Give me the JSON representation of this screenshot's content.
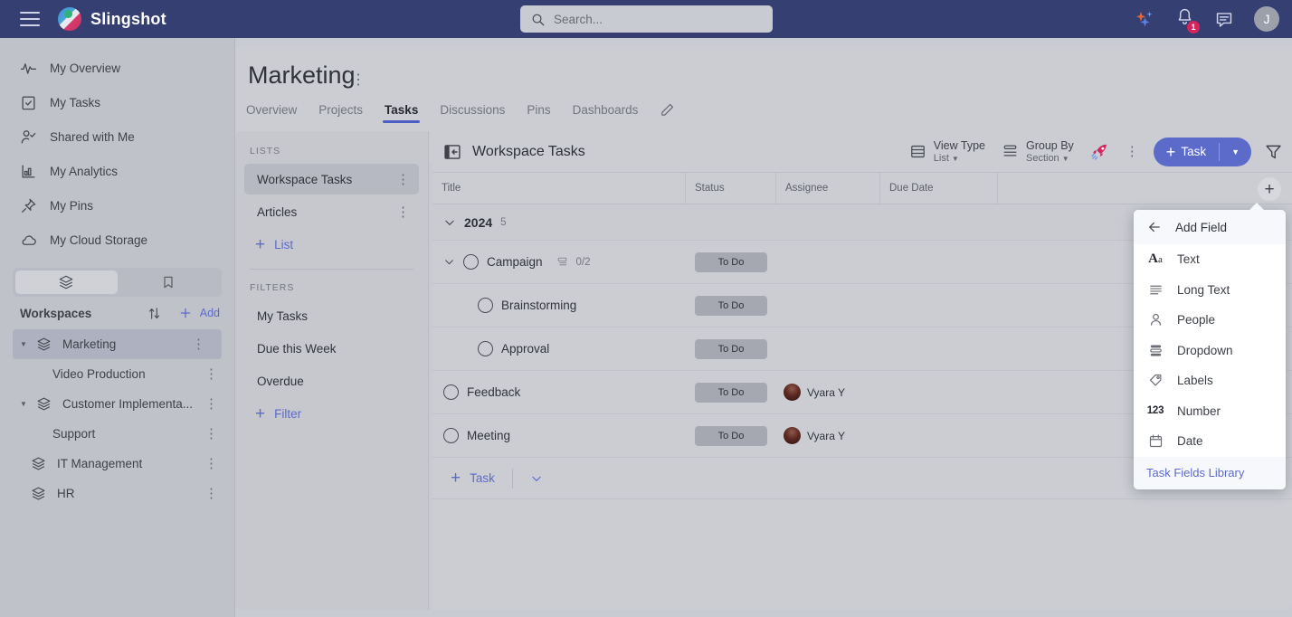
{
  "topbar": {
    "brand": "Slingshot",
    "menu_icon": "hamburger-icon",
    "logo_icon": "slingshot-logo-icon",
    "search_placeholder": "Search...",
    "search_icon": "search-icon",
    "ai_icon": "sparkle-ai-icon",
    "bell_icon": "notification-bell-icon",
    "bell_badge": "1",
    "chat_icon": "chat-icon",
    "avatar_initial": "J"
  },
  "sidebar": {
    "nav": [
      {
        "label": "My Overview",
        "icon": "activity-icon"
      },
      {
        "label": "My Tasks",
        "icon": "clipboard-check-icon"
      },
      {
        "label": "Shared with Me",
        "icon": "person-check-icon"
      },
      {
        "label": "My Analytics",
        "icon": "bar-chart-icon"
      },
      {
        "label": "My Pins",
        "icon": "pin-icon"
      },
      {
        "label": "My Cloud Storage",
        "icon": "cloud-icon"
      }
    ],
    "segments": [
      {
        "icon": "layers-icon",
        "active": true
      },
      {
        "icon": "bookmark-icon",
        "active": false
      }
    ],
    "workspaces_title": "Workspaces",
    "sort_icon": "sort-arrows-icon",
    "add_label": "Add",
    "workspaces": [
      {
        "label": "Marketing",
        "level": 0,
        "expandable": true,
        "selected": true
      },
      {
        "label": "Video Production",
        "level": 1,
        "expandable": false,
        "selected": false
      },
      {
        "label": "Customer Implementa...",
        "level": 0,
        "expandable": true,
        "selected": false
      },
      {
        "label": "Support",
        "level": 1,
        "expandable": false,
        "selected": false
      },
      {
        "label": "IT Management",
        "level": 0,
        "expandable": false,
        "selected": false
      },
      {
        "label": "HR",
        "level": 0,
        "expandable": false,
        "selected": false
      }
    ]
  },
  "page": {
    "title": "Marketing",
    "tabs": [
      {
        "label": "Overview",
        "active": false
      },
      {
        "label": "Projects",
        "active": false
      },
      {
        "label": "Tasks",
        "active": true
      },
      {
        "label": "Discussions",
        "active": false
      },
      {
        "label": "Pins",
        "active": false
      },
      {
        "label": "Dashboards",
        "active": false
      }
    ],
    "edit_icon": "pencil-icon"
  },
  "lists_panel": {
    "lists_header": "LISTS",
    "lists": [
      {
        "label": "Workspace Tasks",
        "selected": true
      },
      {
        "label": "Articles",
        "selected": false
      }
    ],
    "add_list_label": "List",
    "filters_header": "FILTERS",
    "filters": [
      {
        "label": "My Tasks"
      },
      {
        "label": "Due this Week"
      },
      {
        "label": "Overdue"
      }
    ],
    "add_filter_label": "Filter"
  },
  "toolbar": {
    "collapse_icon": "collapse-panel-icon",
    "list_title": "Workspace Tasks",
    "view_type_label": "View Type",
    "view_type_value": "List",
    "view_type_icon": "table-rows-icon",
    "group_by_label": "Group By",
    "group_by_value": "Section",
    "group_by_icon": "group-lines-icon",
    "rocket_icon": "rocket-icon",
    "more_icon": "more-vertical-icon",
    "task_button_label": "Task",
    "task_button_color": "#5c6bc9",
    "task_dropdown_icon": "chevron-down-icon",
    "filter_icon": "funnel-filter-icon"
  },
  "table": {
    "columns": [
      "Title",
      "Status",
      "Assignee",
      "Due Date"
    ],
    "add_field_icon": "plus-icon",
    "group": {
      "name": "2024",
      "count": "5",
      "chevron": "chevron-down-icon"
    },
    "rows": [
      {
        "title": "Campaign",
        "indent": false,
        "expandable": true,
        "subtasks": "0/2",
        "status": "To Do",
        "assignee": "",
        "due": ""
      },
      {
        "title": "Brainstorming",
        "indent": true,
        "expandable": false,
        "subtasks": "",
        "status": "To Do",
        "assignee": "",
        "due": ""
      },
      {
        "title": "Approval",
        "indent": true,
        "expandable": false,
        "subtasks": "",
        "status": "To Do",
        "assignee": "",
        "due": ""
      },
      {
        "title": "Feedback",
        "indent": false,
        "expandable": false,
        "subtasks": "",
        "status": "To Do",
        "assignee": "Vyara Y",
        "due": ""
      },
      {
        "title": "Meeting",
        "indent": false,
        "expandable": false,
        "subtasks": "",
        "status": "To Do",
        "assignee": "Vyara Y",
        "due": ""
      }
    ],
    "add_task_label": "Task",
    "add_task_chevron": "chevron-down-icon"
  },
  "add_field_menu": {
    "back_icon": "arrow-left-icon",
    "title": "Add Field",
    "items": [
      {
        "label": "Text",
        "icon": "text-aa-icon"
      },
      {
        "label": "Long Text",
        "icon": "long-text-lines-icon"
      },
      {
        "label": "People",
        "icon": "person-icon"
      },
      {
        "label": "Dropdown",
        "icon": "dropdown-stack-icon"
      },
      {
        "label": "Labels",
        "icon": "tag-icon"
      },
      {
        "label": "Number",
        "icon": "number-123-icon"
      },
      {
        "label": "Date",
        "icon": "calendar-icon"
      }
    ],
    "footer_label": "Task Fields Library",
    "footer_color": "#5c6bc9"
  }
}
